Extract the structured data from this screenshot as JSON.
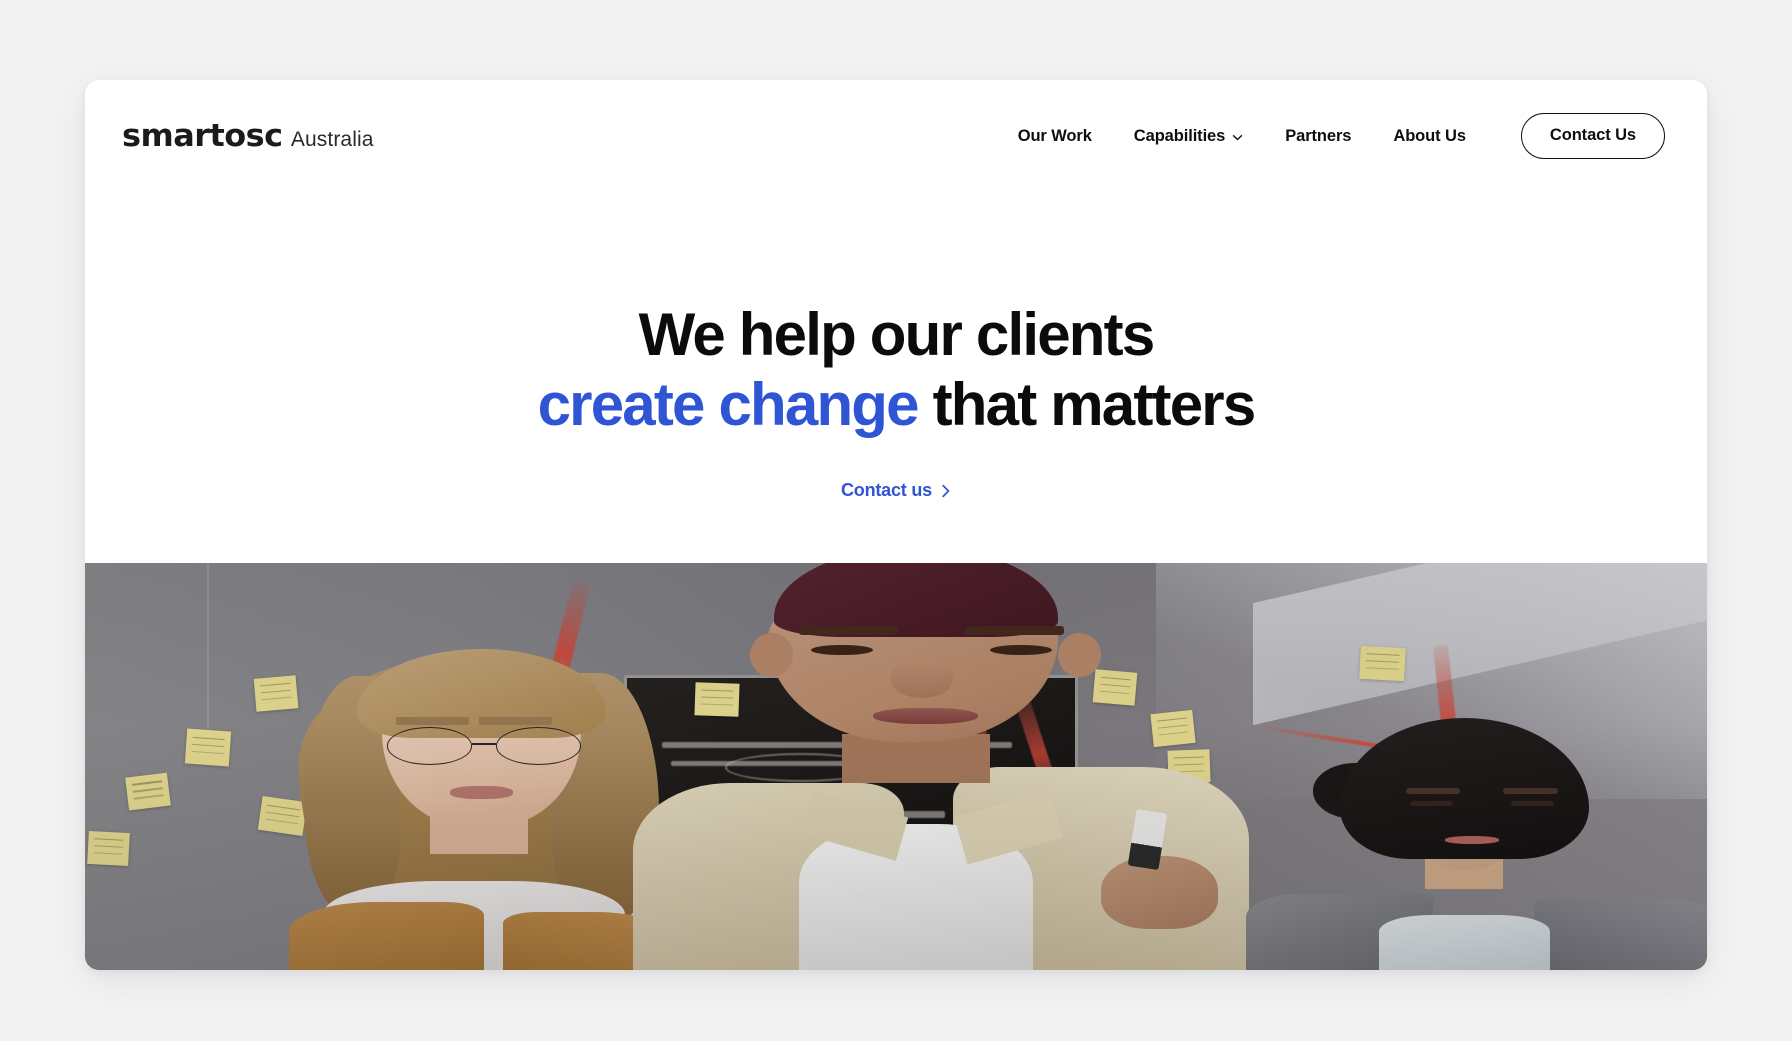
{
  "theme": {
    "page_background": "#f2f2f3",
    "card_background": "#ffffff",
    "accent_blue": "#2f55d4",
    "text_primary": "#0b0b0b"
  },
  "header": {
    "brand": {
      "logo_text": "smartosc",
      "region_text": "Australia"
    },
    "nav_items": [
      {
        "label": "Our Work",
        "has_dropdown": false
      },
      {
        "label": "Capabilities",
        "has_dropdown": true
      },
      {
        "label": "Partners",
        "has_dropdown": false
      },
      {
        "label": "About Us",
        "has_dropdown": false
      }
    ],
    "cta_label": "Contact Us"
  },
  "hero": {
    "title_line_1": "We help our clients",
    "title_line_2_accent": "create change",
    "title_line_2_rest": " that matters",
    "link_label": "Contact us",
    "link_arrow": "›",
    "media_alt": "Three colleagues in a workshop room: a woman with glasses at left, a man in a beige shirt holding a marker writing red notes on a glass board at centre, and a woman in a grey blazer at right, with a blackboard and yellow sticky notes in the background"
  }
}
